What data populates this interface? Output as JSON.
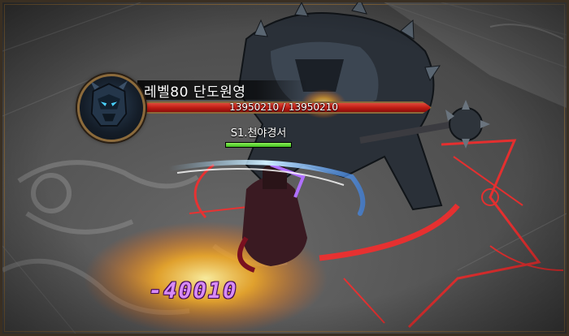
{
  "boss": {
    "name": "레벨80 단도원영",
    "hp_text": "13950210 / 13950210",
    "hp_fraction": 1.0,
    "portrait_icon": "armored-golem-portrait-icon"
  },
  "player": {
    "name": "S1.천야경서",
    "hp_fraction": 1.0
  },
  "combat": {
    "damage_text": "-40010"
  },
  "colors": {
    "boss_hp": "#c01e16",
    "player_hp": "#3fbe1e",
    "damage": "#d88bf5",
    "frame_gold": "#8b6a3b",
    "magic_circle": "#ff2a2a"
  }
}
